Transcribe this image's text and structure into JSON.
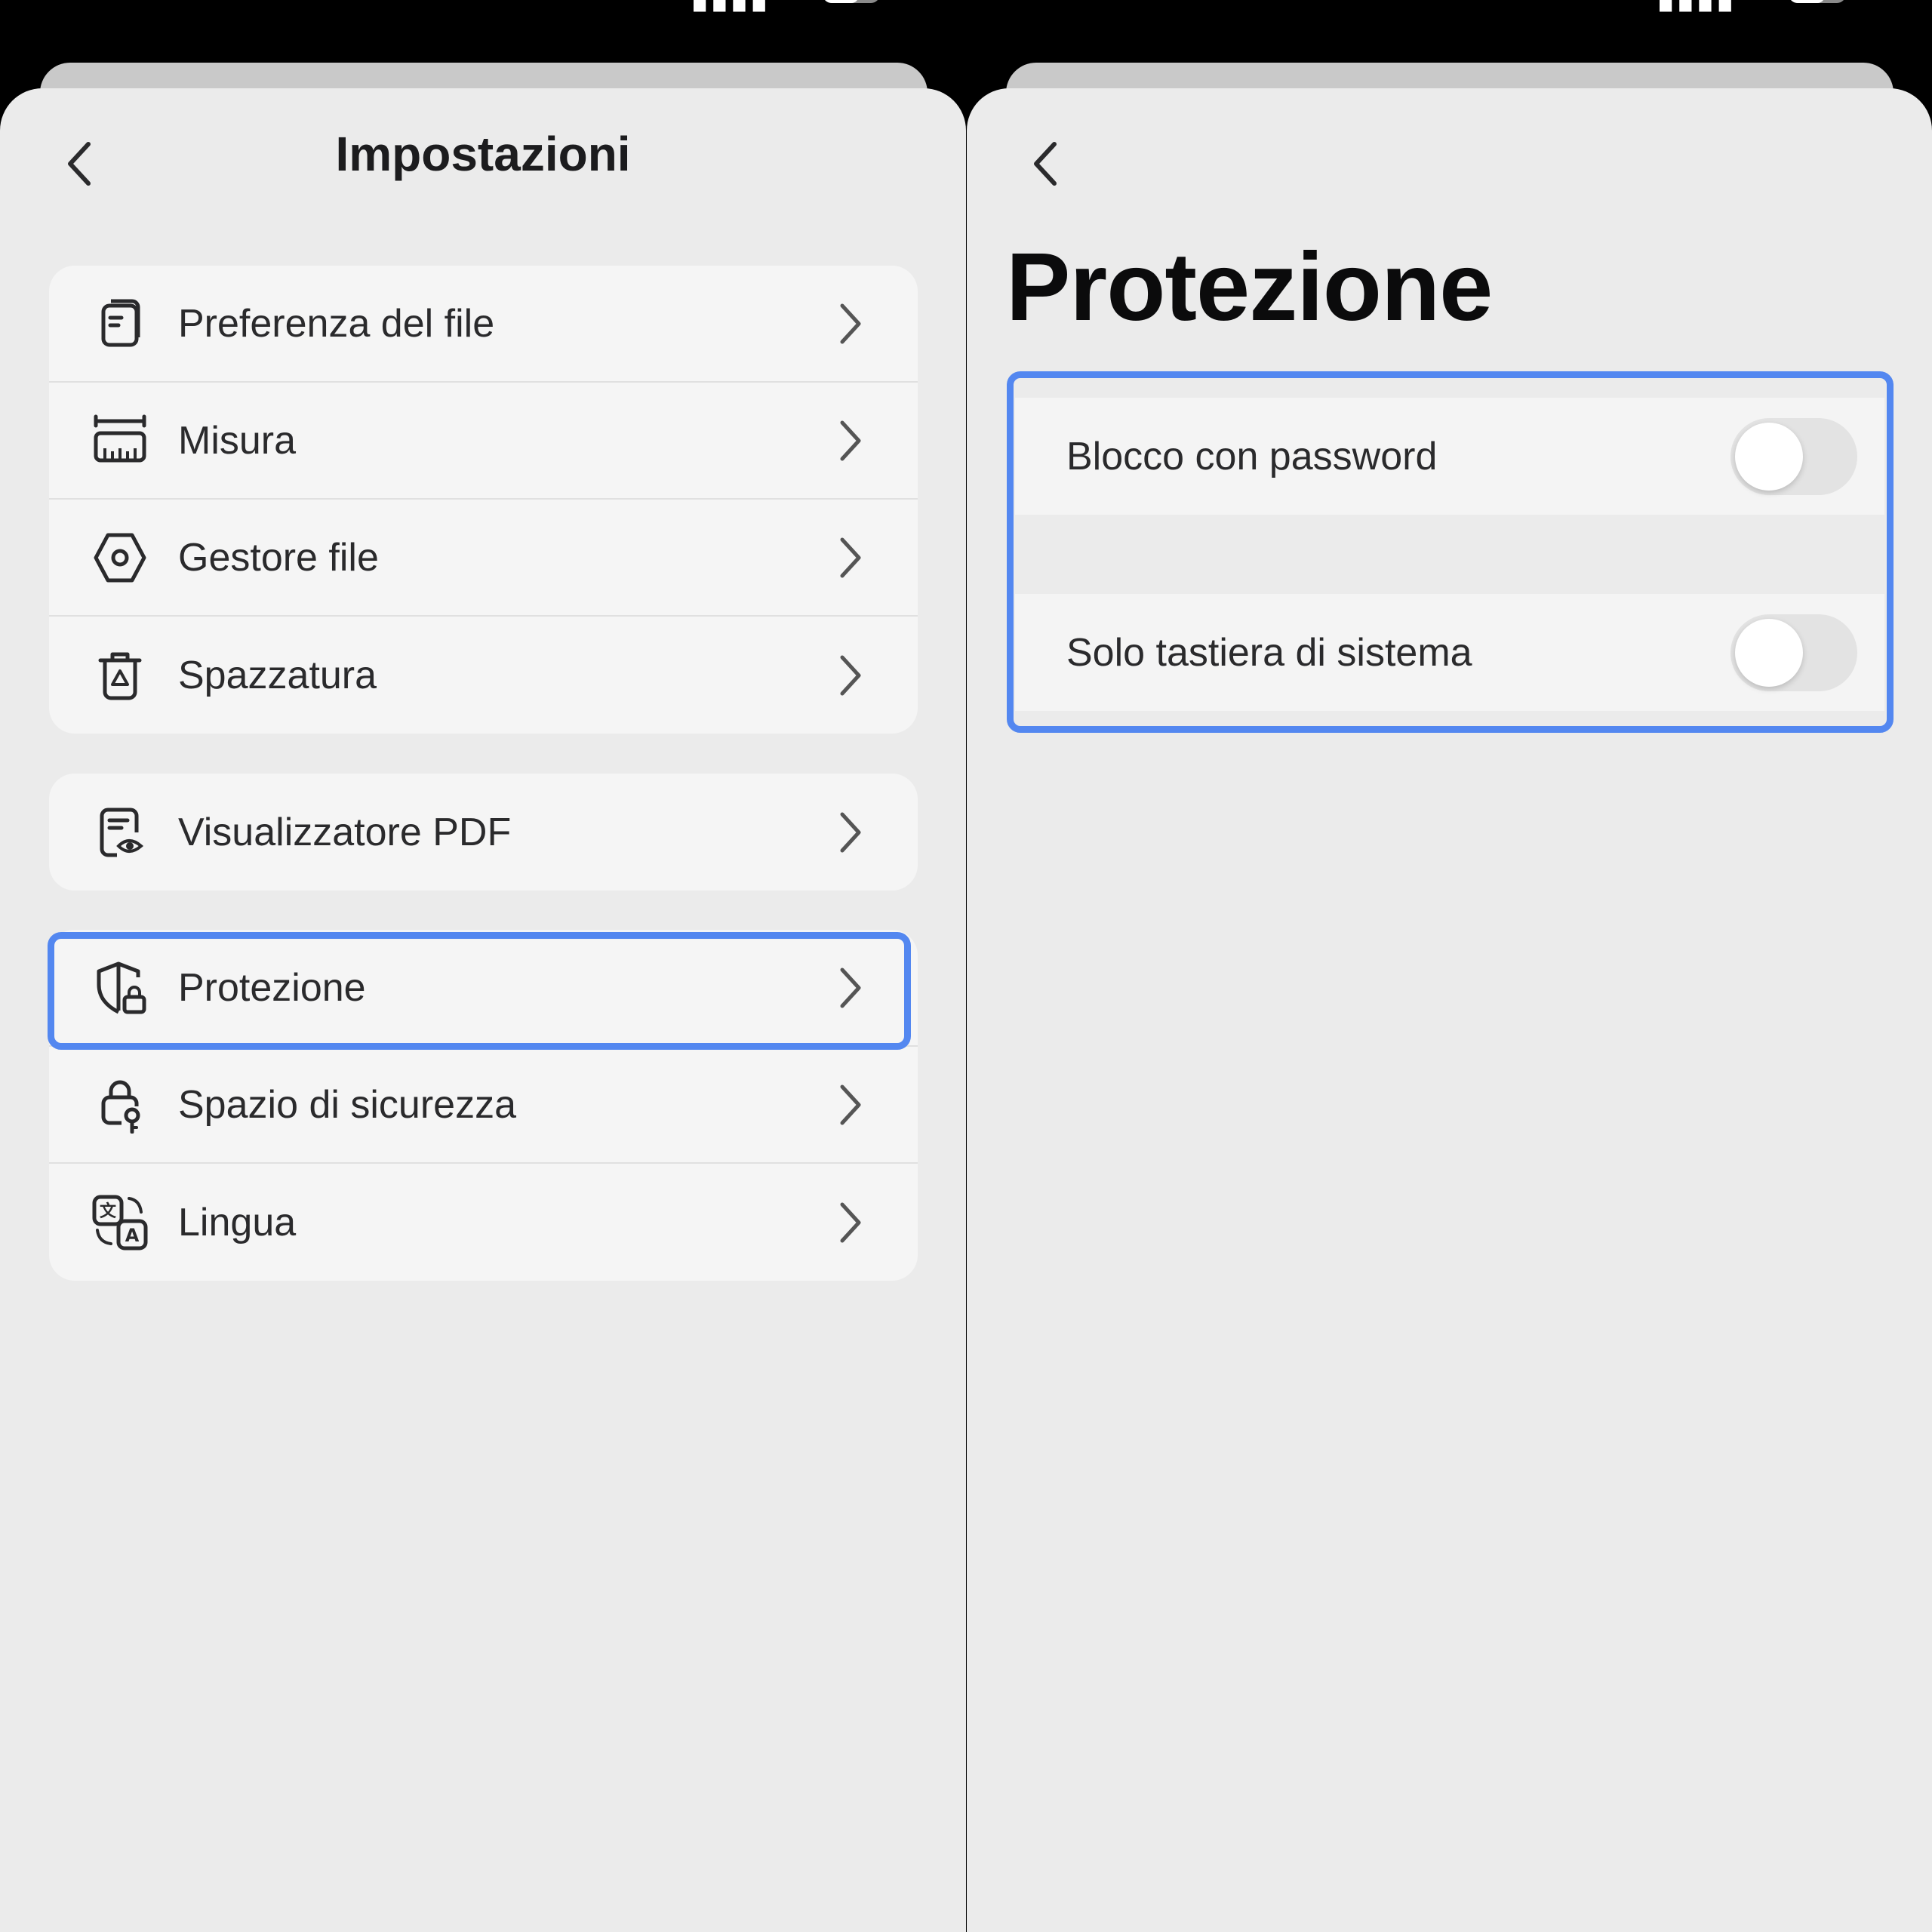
{
  "left": {
    "title": "Impostazioni",
    "groups": [
      [
        {
          "label": "Preferenza del file",
          "icon": "file-preference-icon"
        },
        {
          "label": "Misura",
          "icon": "ruler-icon"
        },
        {
          "label": "Gestore file",
          "icon": "hexagon-nut-icon"
        },
        {
          "label": "Spazzatura",
          "icon": "trash-icon"
        }
      ],
      [
        {
          "label": "Visualizzatore PDF",
          "icon": "pdf-viewer-icon"
        }
      ],
      [
        {
          "label": "Protezione",
          "icon": "shield-lock-icon"
        },
        {
          "label": "Spazio di sicurezza",
          "icon": "lock-key-icon"
        },
        {
          "label": "Lingua",
          "icon": "translate-icon"
        }
      ]
    ]
  },
  "right": {
    "title": "Protezione",
    "toggles": [
      {
        "label": "Blocco con password",
        "on": false
      },
      {
        "label": "Solo tastiera di sistema",
        "on": false
      }
    ]
  },
  "colors": {
    "highlight": "#5387f0",
    "background": "#ebebeb",
    "card": "#f5f5f5"
  }
}
